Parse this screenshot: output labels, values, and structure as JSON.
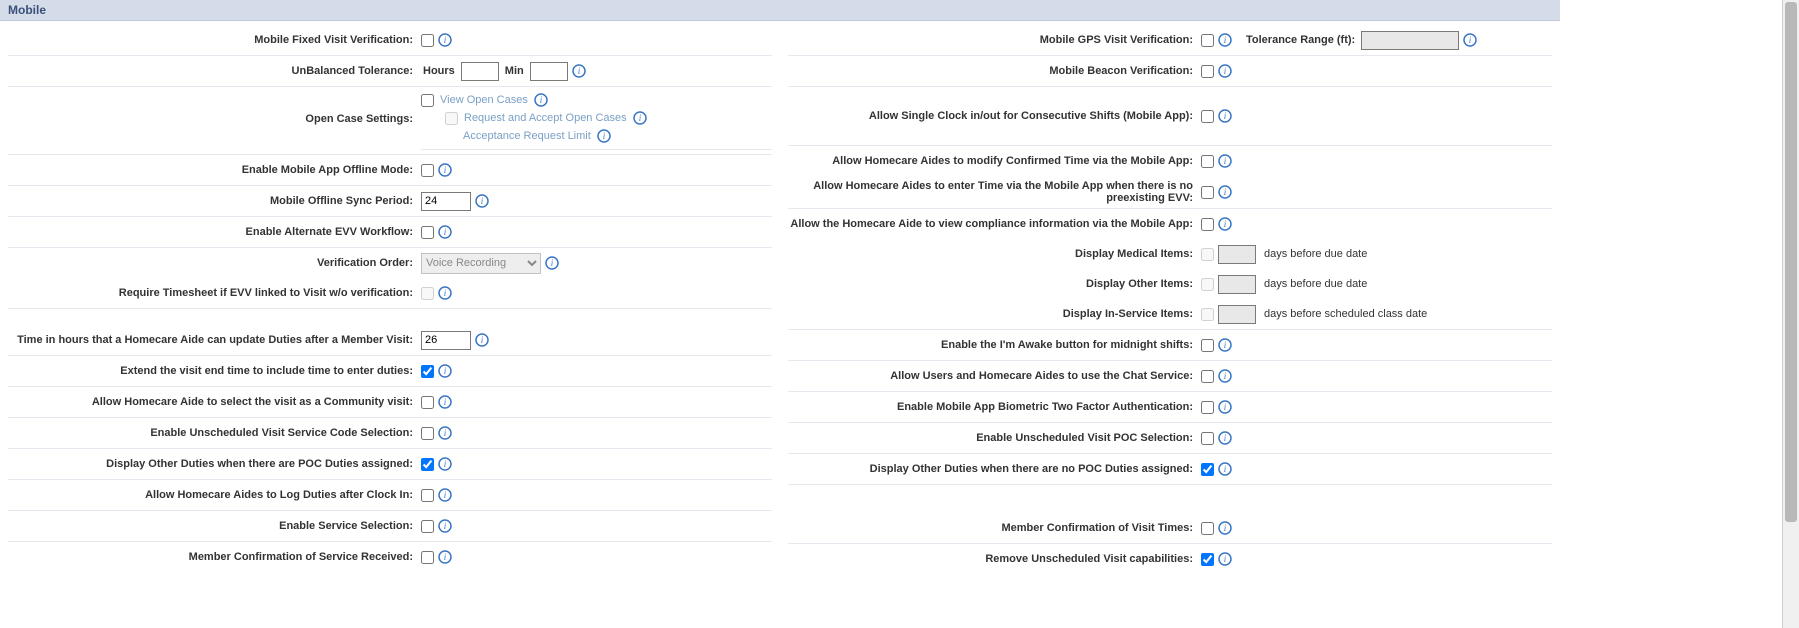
{
  "header": "Mobile",
  "left": {
    "fixed_visit": "Mobile Fixed Visit Verification:",
    "unbalanced_tolerance": "UnBalanced Tolerance:",
    "hours": "Hours",
    "min": "Min",
    "open_case": "Open Case Settings:",
    "view_open_cases": "View Open Cases",
    "request_accept": "Request and Accept Open Cases",
    "acceptance_limit": "Acceptance Request Limit",
    "enable_offline": "Enable Mobile App Offline Mode:",
    "offline_sync": "Mobile Offline Sync Period:",
    "offline_sync_value": "24",
    "enable_alt_evv": "Enable Alternate EVV Workflow:",
    "verification_order": "Verification Order:",
    "verification_order_value": "Voice Recording",
    "require_timesheet": "Require Timesheet if EVV linked to Visit w/o verification:",
    "time_hours_duties": "Time in hours that a Homecare Aide can update Duties after a Member Visit:",
    "time_hours_value": "26",
    "extend_visit_end": "Extend the visit end time to include time to enter duties:",
    "community_visit": "Allow Homecare Aide to select the visit as a Community visit:",
    "unsched_service_code": "Enable Unscheduled Visit Service Code Selection:",
    "display_other_poc": "Display Other Duties when there are POC Duties assigned:",
    "log_duties_clockin": "Allow Homecare Aides to Log Duties after Clock In:",
    "enable_service_sel": "Enable Service Selection:",
    "member_conf_service": "Member Confirmation of Service Received:"
  },
  "right": {
    "gps_visit": "Mobile GPS Visit Verification:",
    "tolerance_range": "Tolerance Range (ft):",
    "beacon": "Mobile Beacon Verification:",
    "single_clock": "Allow Single Clock in/out for Consecutive Shifts (Mobile App):",
    "modify_confirmed": "Allow Homecare Aides to modify Confirmed Time via the Mobile App:",
    "enter_time_no_evv": "Allow Homecare Aides to enter Time via the Mobile App when there is no preexisting EVV:",
    "view_compliance": "Allow the Homecare Aide to view compliance information via the Mobile App:",
    "display_medical": "Display Medical Items:",
    "display_other": "Display Other Items:",
    "display_inservice": "Display In-Service Items:",
    "days_before_due": "days before due date",
    "days_before_class": "days before scheduled class date",
    "im_awake": "Enable the I'm Awake button for midnight shifts:",
    "chat_service": "Allow Users and Homecare Aides to use the Chat Service:",
    "biometric_2fa": "Enable Mobile App Biometric Two Factor Authentication:",
    "unsched_poc": "Enable Unscheduled Visit POC Selection:",
    "display_other_no_poc": "Display Other Duties when there are no POC Duties assigned:",
    "member_conf_times": "Member Confirmation of Visit Times:",
    "remove_unsched": "Remove Unscheduled Visit capabilities:"
  }
}
